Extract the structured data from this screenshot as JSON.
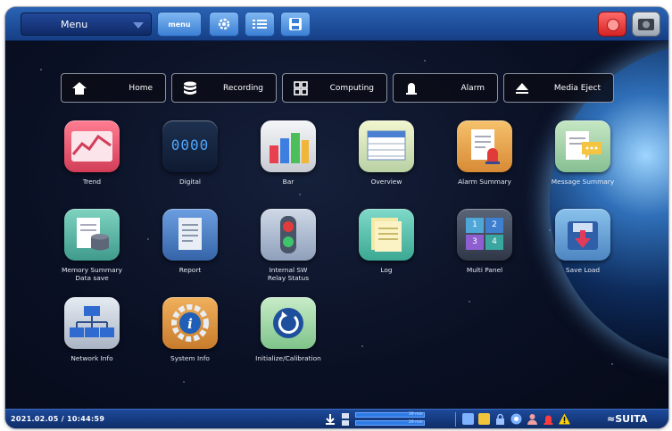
{
  "topbar": {
    "menu_label": "Menu",
    "menu_icon_text": "menu"
  },
  "nav": [
    {
      "label": "Home",
      "icon": "home-icon"
    },
    {
      "label": "Recording",
      "icon": "database-icon"
    },
    {
      "label": "Computing",
      "icon": "grid-icon"
    },
    {
      "label": "Alarm",
      "icon": "alarm-icon"
    },
    {
      "label": "Media Eject",
      "icon": "eject-icon"
    }
  ],
  "tiles": [
    {
      "label": "Trend",
      "icon": "trend-icon"
    },
    {
      "label": "Digital",
      "icon": "digital-display-icon",
      "display": "0000"
    },
    {
      "label": "Bar",
      "icon": "bar-chart-icon"
    },
    {
      "label": "Overview",
      "icon": "overview-table-icon"
    },
    {
      "label": "Alarm Summary",
      "icon": "alarm-document-icon"
    },
    {
      "label": "Message Summary",
      "icon": "message-icon"
    },
    {
      "label": "Memory Summary",
      "label2": "Data save",
      "icon": "memory-database-icon"
    },
    {
      "label": "Report",
      "icon": "report-document-icon"
    },
    {
      "label": "Internal SW",
      "label2": "Relay Status",
      "icon": "traffic-light-icon"
    },
    {
      "label": "Log",
      "icon": "log-notes-icon"
    },
    {
      "label": "Multi Panel",
      "icon": "multi-panel-icon",
      "panels": [
        "1",
        "2",
        "3",
        "4"
      ]
    },
    {
      "label": "Save Load",
      "icon": "save-load-icon"
    },
    {
      "label": "Network Info",
      "icon": "network-icon"
    },
    {
      "label": "System Info",
      "icon": "info-gear-icon"
    },
    {
      "label": "Initialize/Calibration",
      "icon": "reset-icon"
    }
  ],
  "statusbar": {
    "datetime": "2021.02.05 / 10:44:59",
    "logo": "≈SUITA",
    "bar1_value": "39 min",
    "bar2_value": "29 min"
  },
  "colors": {
    "accent": "#2a64b4",
    "alarm_red": "#d42323",
    "warning_yellow": "#ffd000"
  }
}
